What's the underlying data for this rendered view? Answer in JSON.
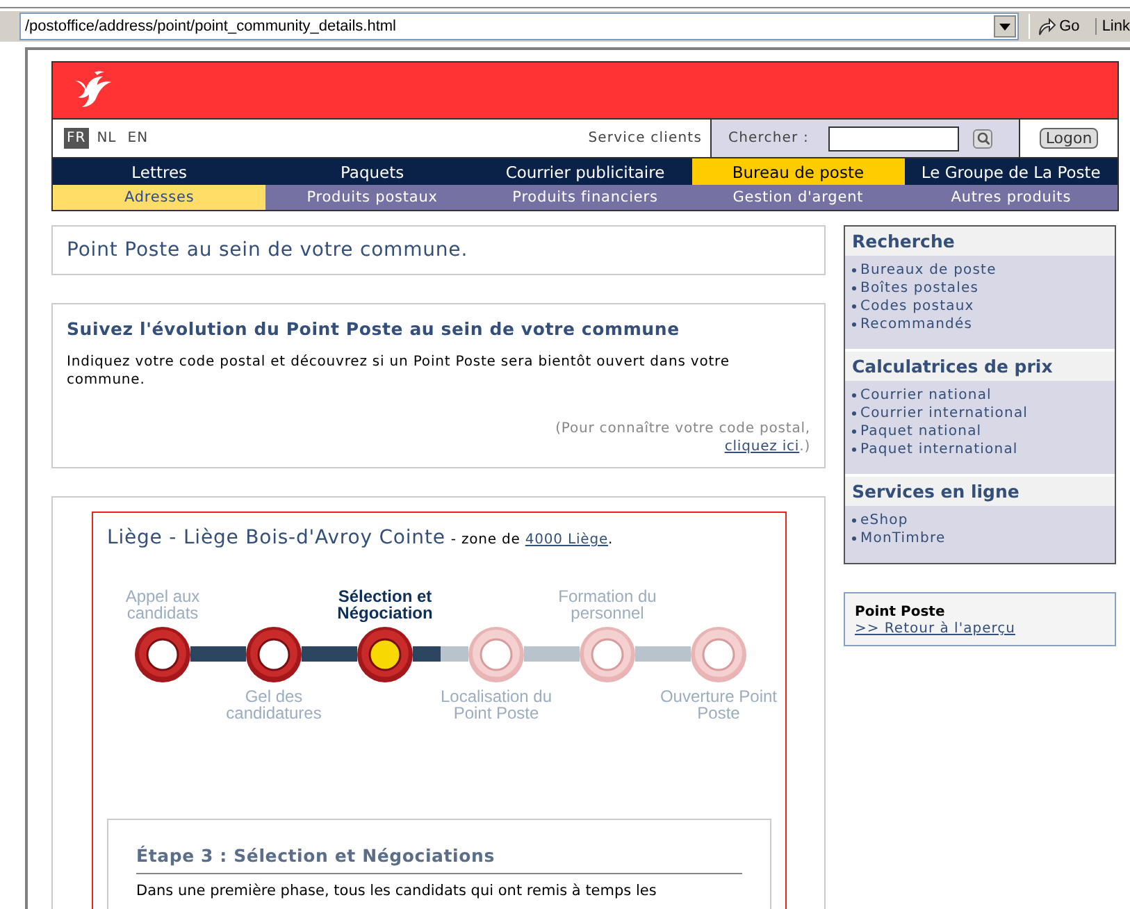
{
  "browser": {
    "address": "/postoffice/address/point/point_community_details.html",
    "go": "Go",
    "links": "Link"
  },
  "header": {
    "languages": [
      {
        "label": "FR",
        "selected": true
      },
      {
        "label": "NL",
        "selected": false
      },
      {
        "label": "EN",
        "selected": false
      }
    ],
    "service": "Service clients",
    "search_label": "Chercher :",
    "logon": "Logon"
  },
  "nav": [
    {
      "label": "Lettres",
      "selected": false
    },
    {
      "label": "Paquets",
      "selected": false
    },
    {
      "label": "Courrier publicitaire",
      "selected": false
    },
    {
      "label": "Bureau de poste",
      "selected": true
    },
    {
      "label": "Le Groupe de La Poste",
      "selected": false
    }
  ],
  "subnav": [
    {
      "label": "Adresses",
      "selected": true
    },
    {
      "label": "Produits postaux",
      "selected": false
    },
    {
      "label": "Produits financiers",
      "selected": false
    },
    {
      "label": "Gestion d'argent",
      "selected": false
    },
    {
      "label": "Autres produits",
      "selected": false
    }
  ],
  "intro": {
    "title": "Point Poste au sein de votre commune."
  },
  "follow": {
    "title": "Suivez l'évolution du Point Poste au sein de votre commune",
    "text": "Indiquez votre code postal et découvrez si un Point Poste sera bientôt ouvert dans votre commune.",
    "note_before": "(Pour connaître votre code postal,",
    "note_link": "cliquez ici",
    "note_after": ".)"
  },
  "location": {
    "title": "Liège - Liège Bois-d'Avroy Cointe",
    "zone_prefix": "- zone de",
    "zone_link": "4000 Liège",
    "zone_suffix": "."
  },
  "steps": [
    {
      "label": "Appel aux candidats",
      "completed": true,
      "selected": false
    },
    {
      "label": "Gel des candidatures",
      "completed": true,
      "selected": false
    },
    {
      "label": "Sélection et Négociation",
      "completed": true,
      "selected": true
    },
    {
      "label": "Localisation du Point Poste",
      "completed": false,
      "selected": false
    },
    {
      "label": "Formation du personnel",
      "completed": false,
      "selected": false
    },
    {
      "label": "Ouverture Point Poste",
      "completed": false,
      "selected": false
    }
  ],
  "stage": {
    "title": "Étape 3 : Sélection et Négociations",
    "text": "Dans une première phase, tous les candidats qui ont remis à temps les"
  },
  "sidebar": [
    {
      "title": "Recherche",
      "items": [
        "Bureaux de poste",
        "Boîtes postales",
        "Codes postaux",
        "Recommandés"
      ]
    },
    {
      "title": "Calculatrices de prix",
      "items": [
        "Courrier national",
        "Courrier international",
        "Paquet national",
        "Paquet international"
      ]
    },
    {
      "title": "Services en ligne",
      "items": [
        "eShop",
        "MonTimbre"
      ]
    }
  ],
  "point_poste": {
    "title": "Point Poste",
    "link": ">> Retour à l'aperçu"
  }
}
